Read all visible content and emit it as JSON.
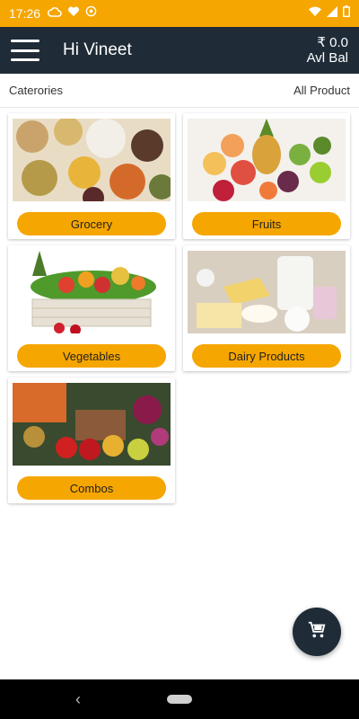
{
  "status_bar": {
    "time": "17:26",
    "icons_left": [
      "cloud-icon",
      "heart-icon",
      "sync-icon"
    ],
    "icons_right": [
      "wifi-icon",
      "signal-icon",
      "battery-icon"
    ]
  },
  "app_bar": {
    "greeting": "Hi Vineet",
    "balance": "₹ 0.0",
    "balance_label": "Avl Bal"
  },
  "sub_header": {
    "left": "Caterories",
    "right": "All Product"
  },
  "categories": [
    {
      "label": "Grocery",
      "image": "grocery-image"
    },
    {
      "label": "Fruits",
      "image": "fruits-image"
    },
    {
      "label": "Vegetables",
      "image": "vegetables-image"
    },
    {
      "label": "Dairy Products",
      "image": "dairy-image"
    },
    {
      "label": "Combos",
      "image": "combos-image"
    }
  ],
  "fab": {
    "icon": "cart-icon"
  },
  "colors": {
    "accent": "#f6a600",
    "appbar": "#1f2c38"
  }
}
